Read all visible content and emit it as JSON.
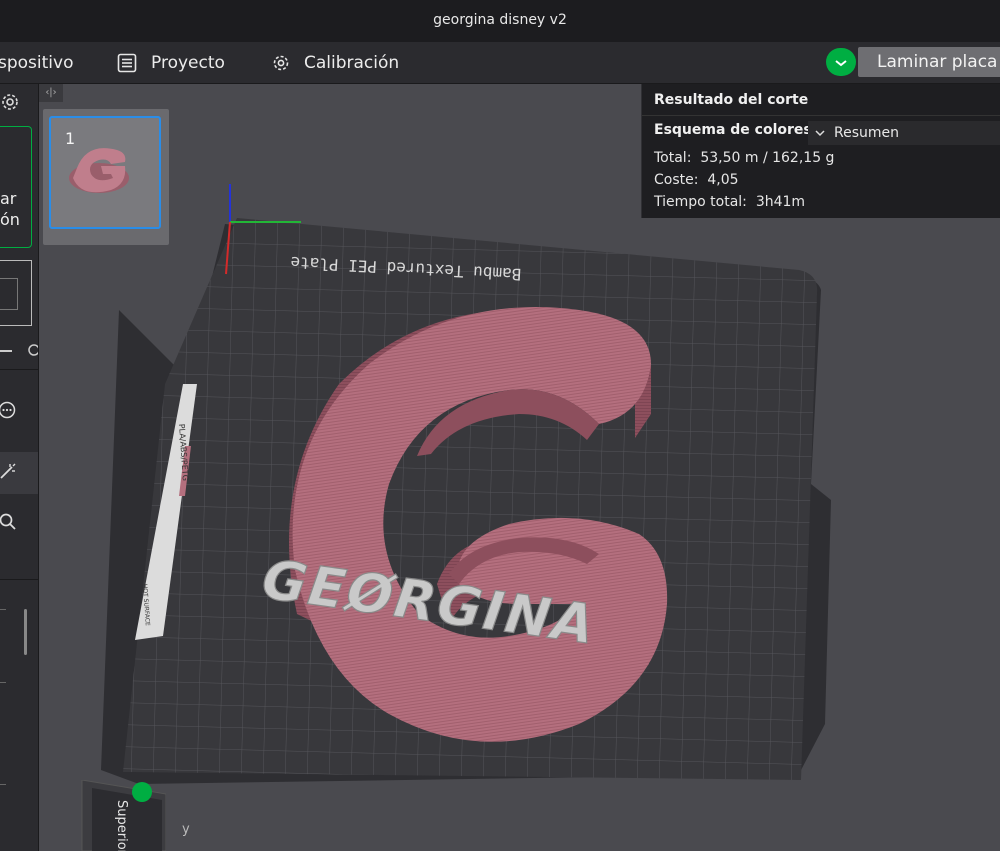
{
  "window": {
    "title": "georgina disney v2"
  },
  "menu": {
    "device_label": "spositivo",
    "project_label": "Proyecto",
    "calibration_label": "Calibración",
    "slice_label": "Laminar placa"
  },
  "left_panel": {
    "partial_text_1": "ar",
    "partial_text_2": "ón"
  },
  "thumbnails": {
    "toggle": "‹|›",
    "plate_number": "1"
  },
  "slice_result": {
    "title": "Resultado del corte",
    "color_scheme_label": "Esquema de colores",
    "color_scheme_value": "Resumen",
    "total_label": "Total:",
    "total_value": "53,50 m / 162,15 g",
    "cost_label": "Coste:",
    "cost_value": "4,05",
    "time_label": "Tiempo total:",
    "time_value": "3h41m"
  },
  "plate": {
    "bed_label": "Bambu Textured PEI Plate",
    "side_label": "PLA/ABS/PETG",
    "side_label_2": "HOT SURFACE",
    "model_text": "GEØRGINA"
  },
  "view_cube": {
    "face_label": "Superior",
    "axis_y": "y"
  },
  "colors": {
    "accent": "#00ae42",
    "model": "#b5707f",
    "bed": "#36363a",
    "selection": "#2a8de8"
  }
}
